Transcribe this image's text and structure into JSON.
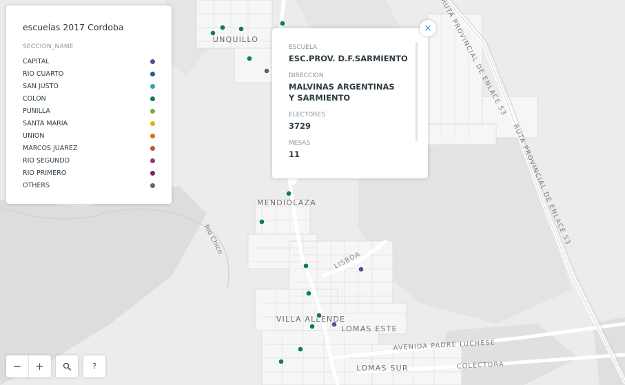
{
  "map": {
    "place_labels": [
      "UNQUILLO",
      "MENDIOLAZA",
      "VILLA ALLENDE",
      "LOMAS ESTE",
      "LOMAS SUR"
    ],
    "road_labels": [
      "RUTA PROVINCIAL DE ENLACE 53",
      "RUTA PROVINCIAL DE ENLACE 53",
      "LISBOA",
      "AVENIDA PADRE LUCHESE",
      "COLECTORA",
      "Rio Chico"
    ]
  },
  "legend": {
    "title": "escuelas 2017 Cordoba",
    "field": "SECCION_NAME",
    "items": [
      {
        "label": "CAPITAL",
        "color": "#5b4a9a"
      },
      {
        "label": "RIO CUARTO",
        "color": "#1f5f95"
      },
      {
        "label": "SAN JUSTO",
        "color": "#36a2a4"
      },
      {
        "label": "COLON",
        "color": "#0f7c57"
      },
      {
        "label": "PUNILLA",
        "color": "#7bab44"
      },
      {
        "label": "SANTA MARIA",
        "color": "#e5ad1c"
      },
      {
        "label": "UNION",
        "color": "#d7750d"
      },
      {
        "label": "MARCOS JUAREZ",
        "color": "#cb4f3a"
      },
      {
        "label": "RIO SEGUNDO",
        "color": "#9c3470"
      },
      {
        "label": "RIO PRIMERO",
        "color": "#6a2b67"
      },
      {
        "label": "OTHERS",
        "color": "#646464"
      }
    ]
  },
  "popup": {
    "fields": [
      {
        "key": "ESCUELA",
        "value": "ESC.PROV. D.F.SARMIENTO"
      },
      {
        "key": "DIRECCION",
        "value": "MALVINAS ARGENTINAS Y SARMIENTO"
      },
      {
        "key": "ELECTORES",
        "value": "3729"
      },
      {
        "key": "MESAS",
        "value": "11"
      }
    ],
    "close_icon": "close-icon"
  },
  "controls": {
    "zoom_out": "−",
    "zoom_in": "+",
    "search_icon": "magnifier-icon",
    "help": "?"
  }
}
